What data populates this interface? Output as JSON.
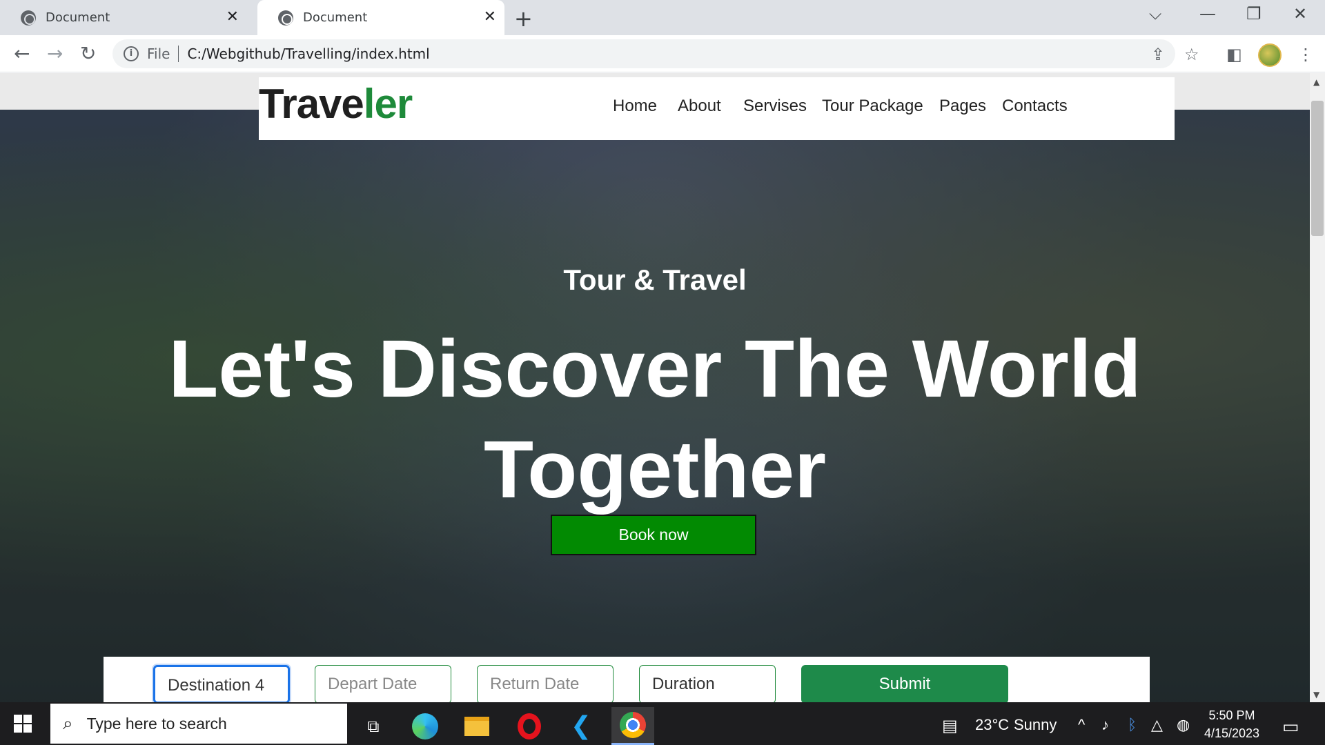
{
  "browser": {
    "tabs": [
      {
        "title": "Document",
        "active": false
      },
      {
        "title": "Document",
        "active": true
      }
    ],
    "url_scheme_label": "File",
    "url": "C:/Webgithub/Travelling/index.html"
  },
  "site": {
    "logo_main": "Trave",
    "logo_accent": "ler",
    "nav": [
      "Home",
      "About",
      "Servises",
      "Tour Package",
      "Pages",
      "Contacts"
    ],
    "hero_subtitle": "Tour & Travel",
    "hero_line1": "Let's Discover The World",
    "hero_line2": "Together",
    "book_button": "Book now",
    "booking_form": {
      "destination_value": "Destination 4",
      "depart_placeholder": "Depart Date",
      "return_placeholder": "Return Date",
      "duration_value": "Duration",
      "submit_label": "Submit"
    },
    "colors": {
      "accent_green": "#1e8a3a",
      "book_green": "#028a02",
      "submit_green": "#1e8a4a"
    }
  },
  "taskbar": {
    "search_placeholder": "Type here to search",
    "weather_temp": "23°C",
    "weather_desc": "Sunny",
    "time": "5:50 PM",
    "date": "4/15/2023",
    "apps": [
      "task-view",
      "edge",
      "file-explorer",
      "opera",
      "vscode",
      "chrome"
    ]
  }
}
